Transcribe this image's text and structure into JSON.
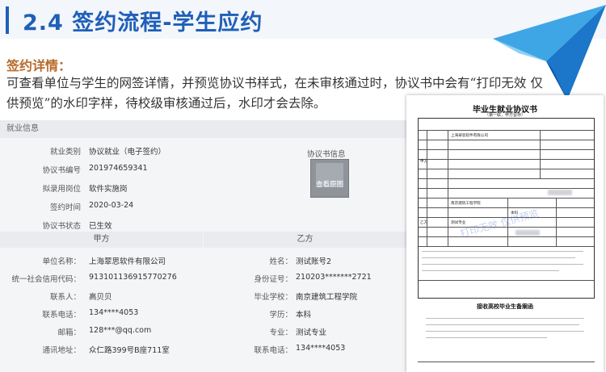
{
  "header": {
    "title": "2.4 签约流程-学生应约"
  },
  "section": {
    "label": "签约详情：",
    "description": "可查看单位与学生的网签详情，并预览协议书样式，在未审核通过时，协议书中会有“打印无效 仅供预览”的水印字样，待校级审核通过后，水印才会去除。"
  },
  "panel": {
    "header": "就业信息",
    "rows": [
      {
        "label": "就业类别",
        "value": "协议就业（电子签约）"
      },
      {
        "label": "协议书编号",
        "value": "201974659341"
      },
      {
        "label": "拟录用岗位",
        "value": "软件实施岗"
      },
      {
        "label": "签约时间",
        "value": "2020-03-24"
      },
      {
        "label": "协议书状态",
        "value": "已生效"
      }
    ],
    "preview_label": "协议书信息",
    "preview_button": "查看原图",
    "party_a_header": "甲方",
    "party_b_header": "乙方",
    "party_a": [
      {
        "label": "单位名称：",
        "value": "上海翠思软件有限公司"
      },
      {
        "label": "统一社会信用代码：",
        "value": "913101136915770276"
      },
      {
        "label": "联系人：",
        "value": "高贝贝"
      },
      {
        "label": "联系电话：",
        "value": "134****4053"
      },
      {
        "label": "邮箱：",
        "value": "128***@qq.com"
      },
      {
        "label": "通讯地址：",
        "value": "众仁路399号B座711室"
      }
    ],
    "party_b": [
      {
        "label": "姓名：",
        "value": "测试账号2"
      },
      {
        "label": "身份证号：",
        "value": "210203*******2721"
      },
      {
        "label": "毕业学校：",
        "value": "南京建筑工程学院"
      },
      {
        "label": "学历：",
        "value": "本科"
      },
      {
        "label": "专业：",
        "value": "测试专业"
      },
      {
        "label": "联系电话：",
        "value": "134****4053"
      }
    ]
  },
  "document": {
    "title": "毕业生就业协议书",
    "subtitle": "（第一联，甲方留存）",
    "company": "上海翠思软件有限公司",
    "party_a_tag": "甲方",
    "party_b_tag": "乙方",
    "watermark": "打印无效 仅供预览",
    "school": "南京建筑工程学院",
    "major": "测试专业",
    "degree": "本科",
    "second_title": "接收高校毕业生备案函"
  }
}
